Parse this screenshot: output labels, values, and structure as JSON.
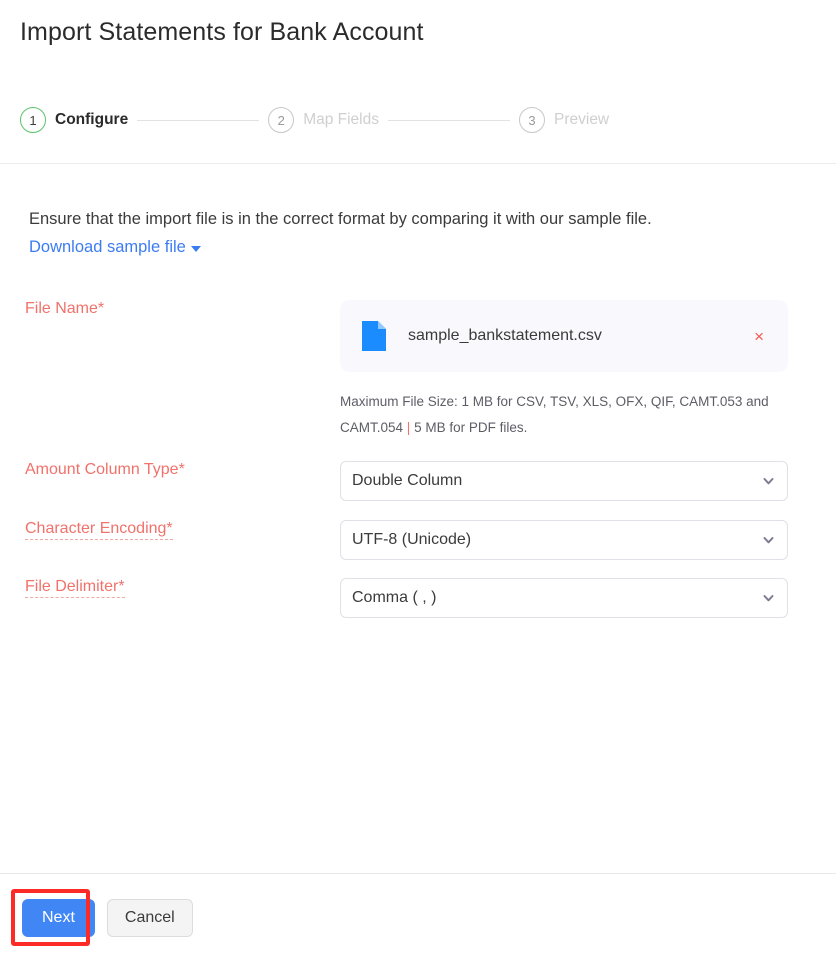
{
  "page": {
    "title": "Import Statements for Bank Account"
  },
  "stepper": {
    "steps": [
      {
        "number": "1",
        "label": "Configure",
        "state": "active"
      },
      {
        "number": "2",
        "label": "Map Fields",
        "state": "inactive"
      },
      {
        "number": "3",
        "label": "Preview",
        "state": "inactive"
      }
    ]
  },
  "intro": {
    "text": "Ensure that the import file is in the correct format by comparing it with our sample file.",
    "link_label": "Download sample file",
    "link_icon": "caret-down-icon",
    "link_color": "#3c7cf2"
  },
  "form": {
    "file_name": {
      "label": "File Name*",
      "required": true,
      "file_icon": "file-document-icon",
      "file_name_value": "sample_bankstatement.csv",
      "remove_icon": "close-icon",
      "hint_line1": "Maximum File Size: 1 MB for CSV, TSV, XLS, OFX, QIF, CAMT.053 and",
      "hint_line2_a": "CAMT.054",
      "hint_separator": "|",
      "hint_line2_b": "5 MB for PDF files."
    },
    "amount_column_type": {
      "label": "Amount Column Type*",
      "value": "Double Column",
      "chevron_icon": "chevron-down-icon",
      "has_tooltip": false
    },
    "character_encoding": {
      "label": "Character Encoding*",
      "value": "UTF-8 (Unicode)",
      "chevron_icon": "chevron-down-icon",
      "has_tooltip": true
    },
    "file_delimiter": {
      "label": "File Delimiter*",
      "value": "Comma ( , )",
      "chevron_icon": "chevron-down-icon",
      "has_tooltip": true
    }
  },
  "footer": {
    "next_label": "Next",
    "cancel_label": "Cancel"
  },
  "colors": {
    "primary_button": "#4186f5",
    "required_label": "#f0726b",
    "link": "#3c7cf2",
    "active_step_ring": "#5cc46c",
    "annotation_highlight": "#fc2b28",
    "file_icon": "#1a8cff"
  }
}
